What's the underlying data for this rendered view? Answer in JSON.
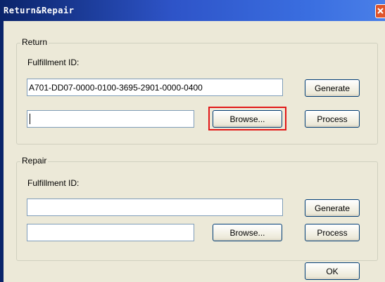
{
  "window": {
    "title": "Return&Repair"
  },
  "return_section": {
    "legend": "Return",
    "fulfillment_label": "Fulfillment ID:",
    "fulfillment_value": "A701-DD07-0000-0100-3695-2901-0000-0400",
    "file_value": "",
    "generate_label": "Generate",
    "browse_label": "Browse...",
    "process_label": "Process"
  },
  "repair_section": {
    "legend": "Repair",
    "fulfillment_label": "Fulfillment ID:",
    "fulfillment_value": "",
    "file_value": "",
    "generate_label": "Generate",
    "browse_label": "Browse...",
    "process_label": "Process"
  },
  "footer": {
    "ok_label": "OK"
  },
  "colors": {
    "highlight": "#e11717",
    "titlebar": "#2e54c8",
    "dialog_bg": "#ece9d8"
  }
}
